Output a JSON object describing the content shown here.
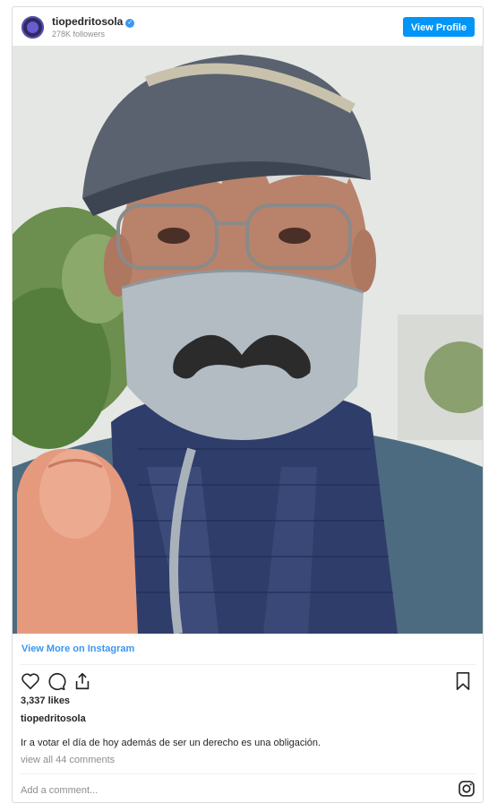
{
  "header": {
    "username": "tiopedritosola",
    "followers": "278K followers",
    "view_profile": "View Profile"
  },
  "photo": {
    "alt": "Selfie of an elderly man wearing a cap, glasses, a grey face mask with a black mustache print and a knitted navy scarf, giving a thumbs up"
  },
  "view_more": "View More on Instagram",
  "actions": {
    "icons": [
      "heart-icon",
      "comment-icon",
      "share-icon",
      "bookmark-icon"
    ]
  },
  "likes": "3,337 likes",
  "caption": {
    "username": "tiopedritosola",
    "text": "Ir a votar el día de hoy además de ser un derecho es una obligación."
  },
  "comments_link": "view all 44 comments",
  "add_comment_placeholder": "Add a comment...",
  "colors": {
    "accent": "#0095f6",
    "link": "#3897f0",
    "muted": "#8e8e8e",
    "border": "#dbdbdb"
  }
}
